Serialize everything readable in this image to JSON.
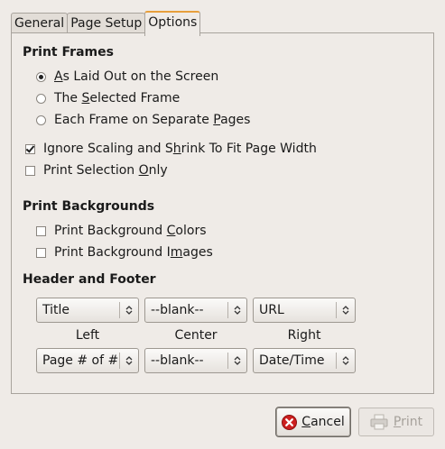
{
  "tabs": [
    "General",
    "Page Setup",
    "Options"
  ],
  "print_frames": {
    "title": "Print Frames",
    "options": [
      {
        "pre": "",
        "key": "A",
        "post": "s Laid Out on the Screen",
        "checked": true
      },
      {
        "pre": "The ",
        "key": "S",
        "post": "elected Frame",
        "checked": false
      },
      {
        "pre": "Each Frame on Separate ",
        "key": "P",
        "post": "ages",
        "checked": false
      }
    ]
  },
  "checks": [
    {
      "pre": "Ignore Scaling and S",
      "key": "h",
      "post": "rink To Fit Page Width",
      "checked": true
    },
    {
      "pre": "Print Selection ",
      "key": "O",
      "post": "nly",
      "checked": false
    }
  ],
  "print_backgrounds": {
    "title": "Print Backgrounds",
    "options": [
      {
        "pre": "Print Background ",
        "key": "C",
        "post": "olors",
        "checked": false
      },
      {
        "pre": "Print Background I",
        "key": "m",
        "post": "ages",
        "checked": false
      }
    ]
  },
  "header_footer": {
    "title": "Header and Footer",
    "header": [
      "Title",
      "--blank--",
      "URL"
    ],
    "labels": [
      "Left",
      "Center",
      "Right"
    ],
    "footer": [
      "Page # of #",
      "--blank--",
      "Date/Time"
    ]
  },
  "buttons": {
    "cancel": {
      "key": "C",
      "rest": "ancel"
    },
    "print": {
      "key": "P",
      "rest": "rint"
    }
  }
}
